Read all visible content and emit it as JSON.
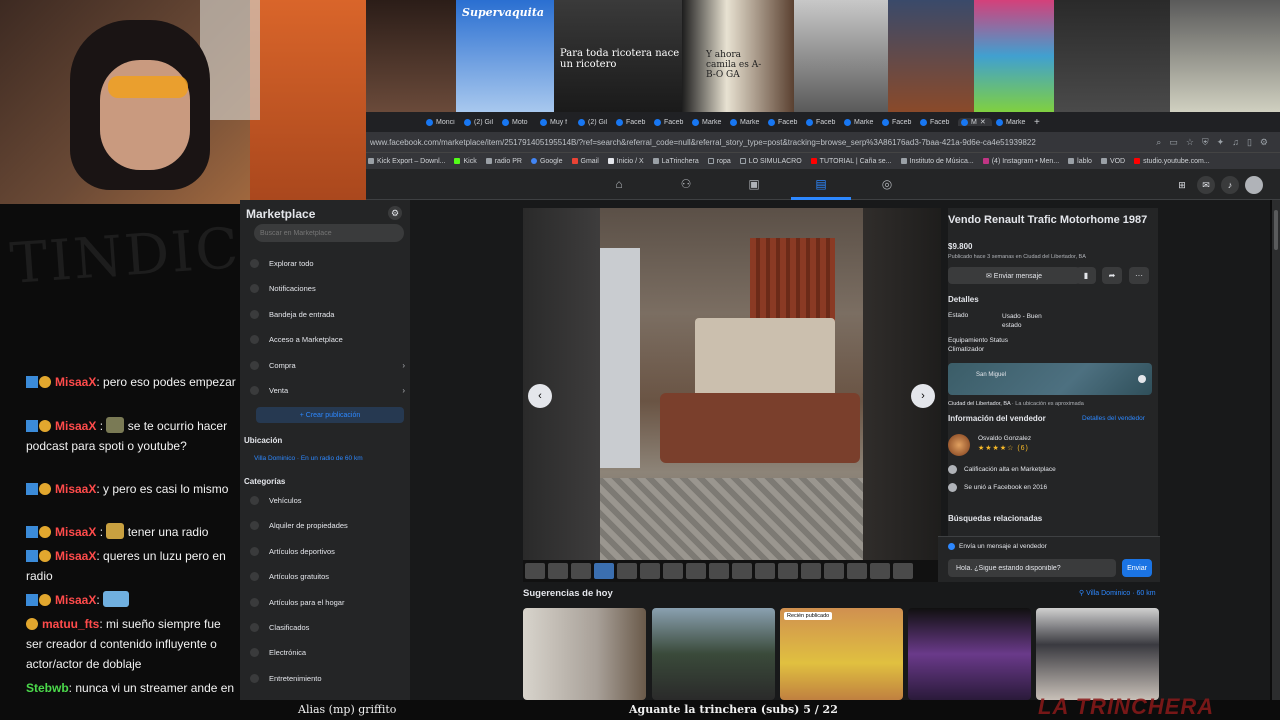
{
  "thumbs": [
    {
      "label": ""
    },
    {
      "label": "Supervaquita"
    },
    {
      "label": "Para toda ricotera nace un ricotero"
    },
    {
      "label": "Y ahora camila es A-B-O GA"
    },
    {
      "label": ""
    },
    {
      "label": ""
    },
    {
      "label": ""
    },
    {
      "label": ""
    },
    {
      "label": ""
    }
  ],
  "browser": {
    "tabs": [
      "Monci",
      "(2) Gil",
      "Moto",
      "Muy f",
      "(2) Gil",
      "Faceb",
      "Faceb",
      "Marke",
      "Marke",
      "Faceb",
      "Faceb",
      "Marke",
      "Faceb",
      "Faceb",
      "M",
      "Marke"
    ],
    "url": "www.facebook.com/marketplace/item/251791405195514B/?ref=search&referral_code=null&referral_story_type=post&tracking=browse_serp%3A86176ad3-7baa-421a-9d6e-ca4e51939822",
    "bookmarks": [
      "Kick Export – Downl...",
      "Kick",
      "radio PR",
      "Google",
      "Gmail",
      "Inicio / X",
      "LaTrinchera",
      "ropa",
      "LO SIMULACRO",
      "TUTORIAL | Caña se...",
      "Instituto de Música...",
      "(4) Instagram • Men...",
      "lablo",
      "VOD",
      "studio.youtube.com..."
    ]
  },
  "sidebar": {
    "title": "Marketplace",
    "search_placeholder": "Buscar en Marketplace",
    "items": [
      {
        "label": "Explorar todo"
      },
      {
        "label": "Notificaciones"
      },
      {
        "label": "Bandeja de entrada"
      },
      {
        "label": "Acceso a Marketplace"
      },
      {
        "label": "Compra"
      },
      {
        "label": "Venta"
      }
    ],
    "create_label": "+ Crear publicación",
    "location_heading": "Ubicación",
    "location_value": "Villa Dominico · En un radio de 60 km",
    "categories_heading": "Categorías",
    "categories": [
      "Vehículos",
      "Alquiler de propiedades",
      "Artículos deportivos",
      "Artículos gratuitos",
      "Artículos para el hogar",
      "Clasificados",
      "Electrónica",
      "Entretenimiento"
    ]
  },
  "listing": {
    "title": "Vendo Renault Trafic Motorhome 1987",
    "price": "$9.800",
    "posted": "Publicado hace 3 semanas en Ciudad del Libertador, BA",
    "message_button": "Enviar mensaje",
    "details_heading": "Detalles",
    "condition_key": "Estado",
    "condition_value": "Usado - Buen estado",
    "equipment": "Equipamiento Status",
    "equipment2": "Climatizador",
    "map_label": "San Miguel",
    "location_line": "Ciudad del Libertador, BA",
    "location_note": " · La ubicación es aproximada",
    "seller_heading": "Información del vendedor",
    "seller_link": "Detalles del vendedor",
    "seller_name": "Osvaldo Gonzalez",
    "seller_stars": "★★★★☆ (6)",
    "seller_rating": "Calificación alta en Marketplace",
    "seller_joined": "Se unió a Facebook en 2016",
    "related_heading": "Búsquedas relacionadas",
    "send_label": "Envía un mensaje al vendedor",
    "send_value": "Hola. ¿Sigue estando disponible?",
    "send_button": "Enviar"
  },
  "suggestions": {
    "title": "Sugerencias de hoy",
    "location": "Villa Dominico · 60 km",
    "badge": "Recién publicado"
  },
  "chat": {
    "bg_text": "TINDIC",
    "messages": [
      {
        "user": "MisaaX",
        "text": ": pero eso podes empezar"
      },
      {
        "user": "MisaaX",
        "text": " se te ocurrio hacer podcast para spoti o youtube?"
      },
      {
        "user": "MisaaX",
        "text": ": y pero es casi lo mismo"
      },
      {
        "user": "MisaaX",
        "text": " tener una radio"
      },
      {
        "user": "MisaaX",
        "text": ": queres un luzu pero en radio"
      },
      {
        "user": "MisaaX",
        "text": ":"
      },
      {
        "user": "matuu_fts",
        "text": ": mi sueño siempre fue ser creador d contenido influyente o actor/actor de doblaje"
      },
      {
        "user": "Stebwb",
        "text": ": nunca vi un streamer ande en motorhome"
      }
    ]
  },
  "overlay": {
    "alias": "Alias (mp) griffito",
    "goal": "Aguante la trinchera (subs) 5 / 22",
    "logo": "LA TRINCHERA"
  },
  "colors": {
    "fb_blue": "#2d88ff",
    "fb_bg": "#18191a",
    "fb_card": "#242526",
    "chat_red": "#ff4b4b",
    "chat_green": "#4bd94b"
  }
}
